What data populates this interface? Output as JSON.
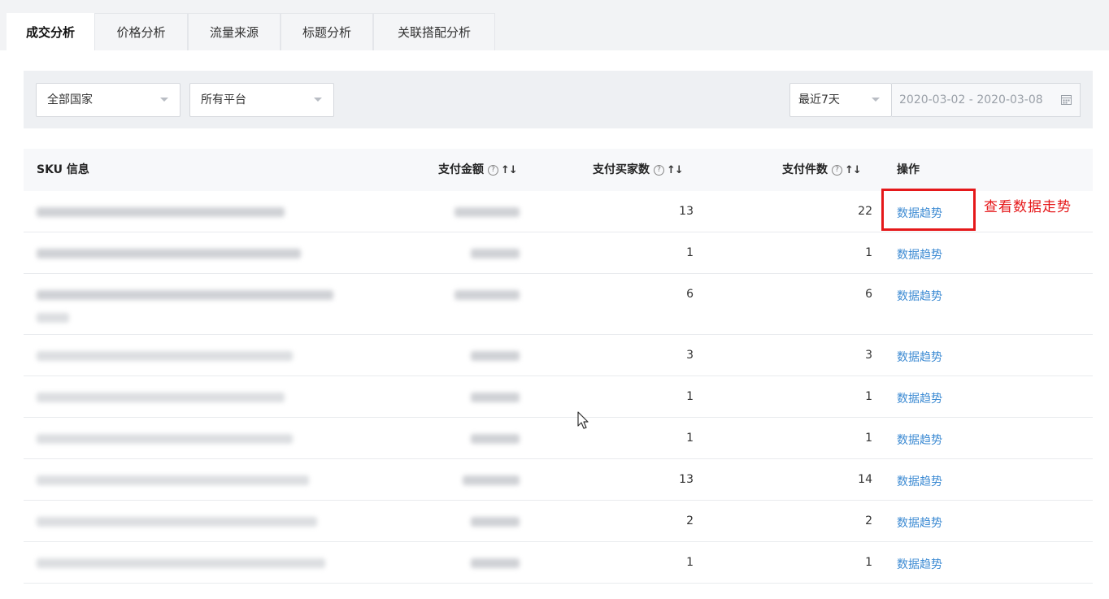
{
  "tabs": [
    {
      "label": "成交分析",
      "active": true
    },
    {
      "label": "价格分析",
      "active": false
    },
    {
      "label": "流量来源",
      "active": false
    },
    {
      "label": "标题分析",
      "active": false
    },
    {
      "label": "关联搭配分析",
      "active": false
    }
  ],
  "filters": {
    "country": "全部国家",
    "platform": "所有平台",
    "period": "最近7天",
    "date_range": "2020-03-02 - 2020-03-08"
  },
  "table": {
    "headers": {
      "sku": "SKU 信息",
      "amount": "支付金额",
      "buyers": "支付买家数",
      "items": "支付件数",
      "action": "操作"
    },
    "sort_glyph": "↑↓",
    "help_glyph": "?",
    "rows": [
      {
        "buyers": "13",
        "items": "22",
        "action": "数据趋势"
      },
      {
        "buyers": "1",
        "items": "1",
        "action": "数据趋势"
      },
      {
        "buyers": "6",
        "items": "6",
        "action": "数据趋势"
      },
      {
        "buyers": "3",
        "items": "3",
        "action": "数据趋势"
      },
      {
        "buyers": "1",
        "items": "1",
        "action": "数据趋势"
      },
      {
        "buyers": "1",
        "items": "1",
        "action": "数据趋势"
      },
      {
        "buyers": "13",
        "items": "14",
        "action": "数据趋势"
      },
      {
        "buyers": "2",
        "items": "2",
        "action": "数据趋势"
      },
      {
        "buyers": "1",
        "items": "1",
        "action": "数据趋势"
      }
    ]
  },
  "annotation": {
    "text": "查看数据走势",
    "color": "#e5181a"
  },
  "colors": {
    "link": "#3d8bd3",
    "tabbar_bg": "#f2f3f5",
    "filter_bg": "#eef0f3"
  }
}
